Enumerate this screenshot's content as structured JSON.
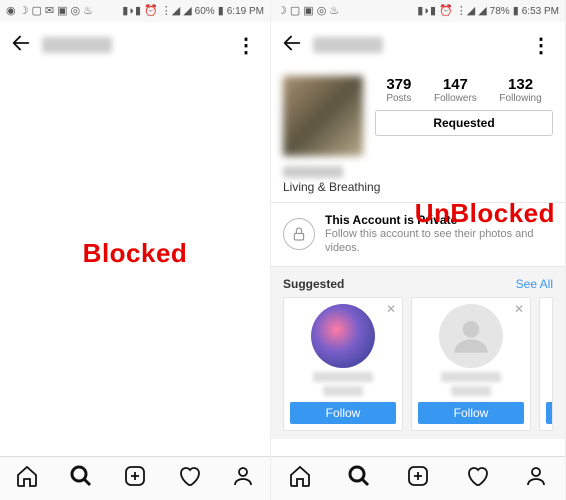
{
  "left": {
    "status": {
      "battery": "60%",
      "time": "6:19 PM"
    },
    "overlay_label": "Blocked"
  },
  "right": {
    "status": {
      "battery": "78%",
      "time": "6:53 PM"
    },
    "overlay_label": "UnBlocked",
    "stats": {
      "posts_num": "379",
      "posts_label": "Posts",
      "followers_num": "147",
      "followers_label": "Followers",
      "following_num": "132",
      "following_label": "Following"
    },
    "requested_label": "Requested",
    "bio": "Living & Breathing",
    "private": {
      "title": "This Account is Private",
      "subtitle": "Follow this account to see their photos and videos."
    },
    "suggested": {
      "label": "Suggested",
      "see_all": "See All"
    },
    "follow_label": "Follow"
  }
}
